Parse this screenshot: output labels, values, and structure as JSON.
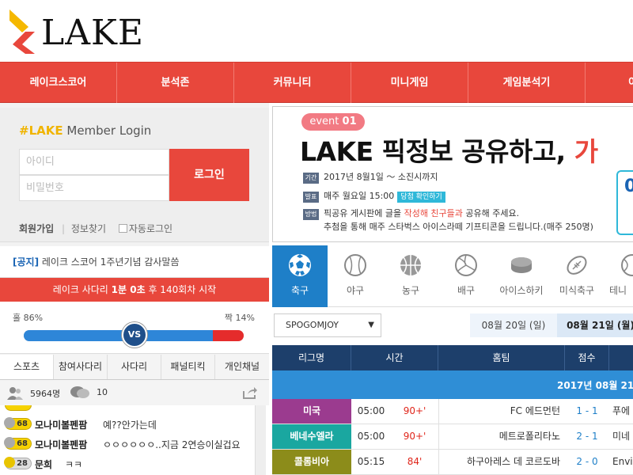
{
  "logo": {
    "text": "LAKE"
  },
  "nav": {
    "items": [
      "레이크스코어",
      "분석존",
      "커뮤니티",
      "미니게임",
      "게임분석기",
      "이"
    ]
  },
  "login": {
    "title_brand": "#LAKE",
    "title_rest": " Member Login",
    "id_placeholder": "아이디",
    "pw_placeholder": "비밀번호",
    "login_button": "로그인",
    "join": "회원가입",
    "sep": "|",
    "find": "정보찾기",
    "auto": "자동로그인"
  },
  "notice": {
    "tag": "[공지]",
    "text": " 레이크 스코어 1주년기념 감사말씀"
  },
  "ladder": {
    "prefix": "레이크 사다리 ",
    "minute": "1분 0초",
    "suffix": " 후 140회차 시작"
  },
  "vote": {
    "left_label": "홀 86%",
    "right_label": "짝 14%",
    "left_pct": 86,
    "vs": "VS"
  },
  "chat": {
    "tabs": [
      "스포츠",
      "참여사다리",
      "사다리",
      "패널티킥",
      "개인채널"
    ],
    "users": "5964명",
    "comments": "10",
    "rows": [
      {
        "level": "68",
        "nick": "모나미볼펜팜",
        "msg": "예??안가는데"
      },
      {
        "level": "68",
        "nick": "모나미볼펜팜",
        "msg": "ㅇㅇㅇㅇㅇㅇ..지금 2연승이실겁요"
      },
      {
        "level": "28",
        "nick": "문희",
        "msg": "ㅋㅋ"
      }
    ]
  },
  "banner": {
    "event_label": "event",
    "event_num": "01",
    "title": "LAKE 픽정보 공유하고, ",
    "title_red": "가",
    "rows": [
      {
        "tag": "기간",
        "text": "2017년 8월1일 ～ 소진시까지"
      },
      {
        "tag": "발표",
        "text": "매주 월요일 15:00",
        "badge": "당첨 확인하기"
      },
      {
        "tag": "방법",
        "text_a": "픽공유 게시판에 글을 ",
        "text_red": "작성해 친구들과",
        "text_b": " 공유해 주세요."
      },
      {
        "tag": "",
        "text": "추첨을 통해 매주 스타벅스 아이스라떼 기프티콘을 드립니다.(매주 250명)"
      }
    ],
    "box_text": "0"
  },
  "sports": {
    "items": [
      {
        "label": "축구",
        "icon": "soccer-ball-icon"
      },
      {
        "label": "야구",
        "icon": "baseball-icon"
      },
      {
        "label": "농구",
        "icon": "basketball-icon"
      },
      {
        "label": "배구",
        "icon": "volleyball-icon"
      },
      {
        "label": "아이스하키",
        "icon": "hockey-puck-icon"
      },
      {
        "label": "미식축구",
        "icon": "football-icon"
      },
      {
        "label": "테니",
        "icon": "tennis-icon"
      }
    ]
  },
  "dates": {
    "select": "SPOGOMJOY",
    "d1": "08월 20일 (일)",
    "d2": "08월 21일 (월)"
  },
  "table": {
    "headers": [
      "리그명",
      "시간",
      "홈팀",
      "점수",
      ""
    ],
    "date_line": "2017년 08월 21",
    "rows": [
      {
        "league": "미국",
        "color": "#9b3b8f",
        "time": "05:00",
        "odds": "90+'",
        "home": "FC 에드먼턴",
        "score": "1 - 1",
        "away": "푸에"
      },
      {
        "league": "베네수엘라",
        "color": "#1aa7a0",
        "time": "05:00",
        "odds": "90+'",
        "home": "메트로폴리타노",
        "score": "2 - 1",
        "away": "미네"
      },
      {
        "league": "콜롬비아",
        "color": "#8c8c1a",
        "time": "05:15",
        "odds": "84'",
        "home": "하구아레스 데 코르도바",
        "score": "2 - 0",
        "away": "Envi"
      }
    ]
  },
  "colors": {
    "accent": "#e8473c",
    "navy": "#1d3f6b",
    "blue": "#2f8ed6",
    "logo_yellow": "#f5b800",
    "logo_red": "#e8473c"
  }
}
